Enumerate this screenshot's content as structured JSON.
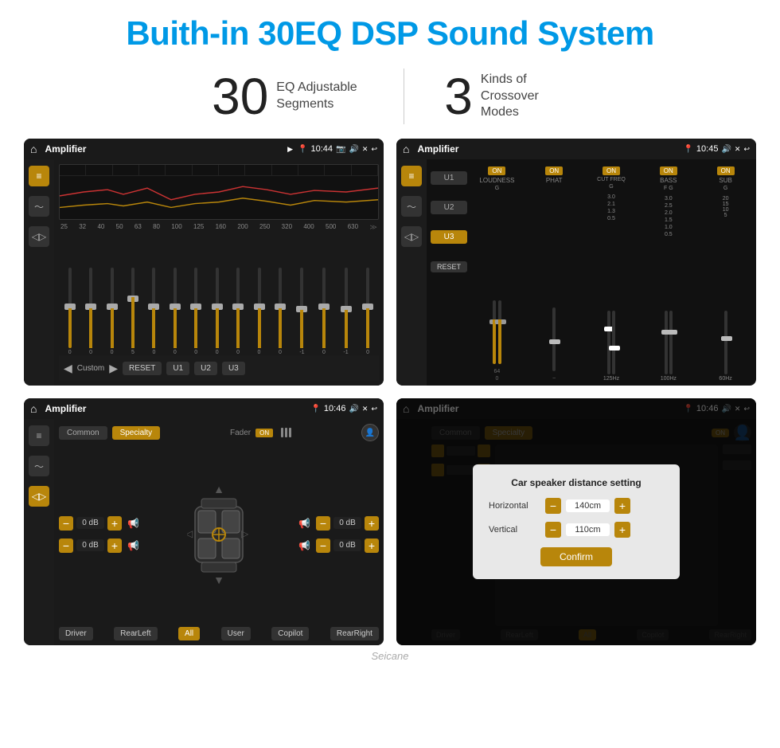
{
  "page": {
    "title": "Buith-in 30EQ DSP Sound System",
    "stat1_number": "30",
    "stat1_label": "EQ Adjustable Segments",
    "stat2_number": "3",
    "stat2_label": "Kinds of Crossover Modes"
  },
  "screen1": {
    "app_name": "Amplifier",
    "time": "10:44",
    "eq_labels": [
      "25",
      "32",
      "40",
      "50",
      "63",
      "80",
      "100",
      "125",
      "160",
      "200",
      "250",
      "320",
      "400",
      "500",
      "630"
    ],
    "sliders": [
      {
        "value": "0",
        "pos": 50
      },
      {
        "value": "0",
        "pos": 50
      },
      {
        "value": "0",
        "pos": 50
      },
      {
        "value": "5",
        "pos": 45
      },
      {
        "value": "0",
        "pos": 50
      },
      {
        "value": "0",
        "pos": 50
      },
      {
        "value": "0",
        "pos": 50
      },
      {
        "value": "0",
        "pos": 50
      },
      {
        "value": "0",
        "pos": 50
      },
      {
        "value": "0",
        "pos": 50
      },
      {
        "value": "0",
        "pos": 50
      },
      {
        "value": "-1",
        "pos": 52
      },
      {
        "value": "0",
        "pos": 50
      },
      {
        "value": "-1",
        "pos": 52
      },
      {
        "value": "0",
        "pos": 50
      }
    ],
    "preset": "Custom",
    "buttons": [
      "RESET",
      "U1",
      "U2",
      "U3"
    ]
  },
  "screen2": {
    "app_name": "Amplifier",
    "time": "10:45",
    "active_tab": "U3",
    "channels": [
      {
        "name": "LOUDNESS",
        "on": true,
        "label": "G"
      },
      {
        "name": "PHAT",
        "on": true,
        "label": ""
      },
      {
        "name": "CUT FREQ",
        "on": true,
        "label": "G"
      },
      {
        "name": "BASS",
        "on": true,
        "label": "F G"
      },
      {
        "name": "SUB",
        "on": true,
        "label": "G"
      }
    ],
    "reset_label": "RESET",
    "u_buttons": [
      "U1",
      "U2",
      "U3"
    ]
  },
  "screen3": {
    "app_name": "Amplifier",
    "time": "10:46",
    "tabs": [
      "Common",
      "Specialty"
    ],
    "active_tab": "Specialty",
    "fader_label": "Fader",
    "fader_on": "ON",
    "controls": {
      "front_left_db": "0 dB",
      "front_right_db": "0 dB",
      "rear_left_db": "0 dB",
      "rear_right_db": "0 dB"
    },
    "position_buttons": [
      "Driver",
      "RearLeft",
      "All",
      "User",
      "Copilot",
      "RearRight"
    ]
  },
  "screen4": {
    "app_name": "Amplifier",
    "time": "10:46",
    "tabs": [
      "Common",
      "Specialty"
    ],
    "active_tab": "Specialty",
    "dialog": {
      "title": "Car speaker distance setting",
      "horizontal_label": "Horizontal",
      "horizontal_value": "140cm",
      "vertical_label": "Vertical",
      "vertical_value": "110cm",
      "confirm_label": "Confirm"
    },
    "position_buttons": [
      "Driver",
      "RearLeft",
      "All",
      "Copilot",
      "RearRight"
    ]
  },
  "brand": "Seicane",
  "colors": {
    "accent": "#b8860b",
    "blue": "#0099e6",
    "bg_dark": "#1a1a1a",
    "bg_darker": "#111"
  }
}
